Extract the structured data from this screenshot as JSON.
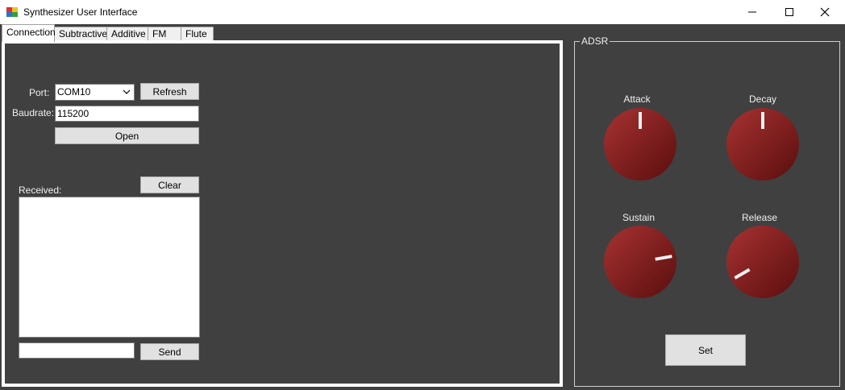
{
  "window": {
    "title": "Synthesizer User Interface",
    "icons": {
      "app": "app-icon",
      "minimize": "minimize-icon",
      "maximize": "maximize-icon",
      "close": "close-icon"
    }
  },
  "tabs": [
    {
      "label": "Connection",
      "active": true
    },
    {
      "label": "Subtractive",
      "active": false
    },
    {
      "label": "Additive",
      "active": false
    },
    {
      "label": "FM",
      "active": false
    },
    {
      "label": "Flute",
      "active": false
    }
  ],
  "connection": {
    "port_label": "Port:",
    "port_value": "COM10",
    "refresh_label": "Refresh",
    "baudrate_label": "Baudrate:",
    "baudrate_value": "115200",
    "open_label": "Open",
    "received_label": "Received:",
    "clear_label": "Clear",
    "received_text": "",
    "send_input_value": "",
    "send_label": "Send"
  },
  "adsr": {
    "title": "ADSR",
    "knobs": [
      {
        "label": "Attack",
        "angle_deg": 0
      },
      {
        "label": "Decay",
        "angle_deg": 0
      },
      {
        "label": "Sustain",
        "angle_deg": 80
      },
      {
        "label": "Release",
        "angle_deg": -120
      }
    ],
    "set_label": "Set",
    "knob_color": "#8b1a1a",
    "indicator_color": "#f0f0f0"
  }
}
